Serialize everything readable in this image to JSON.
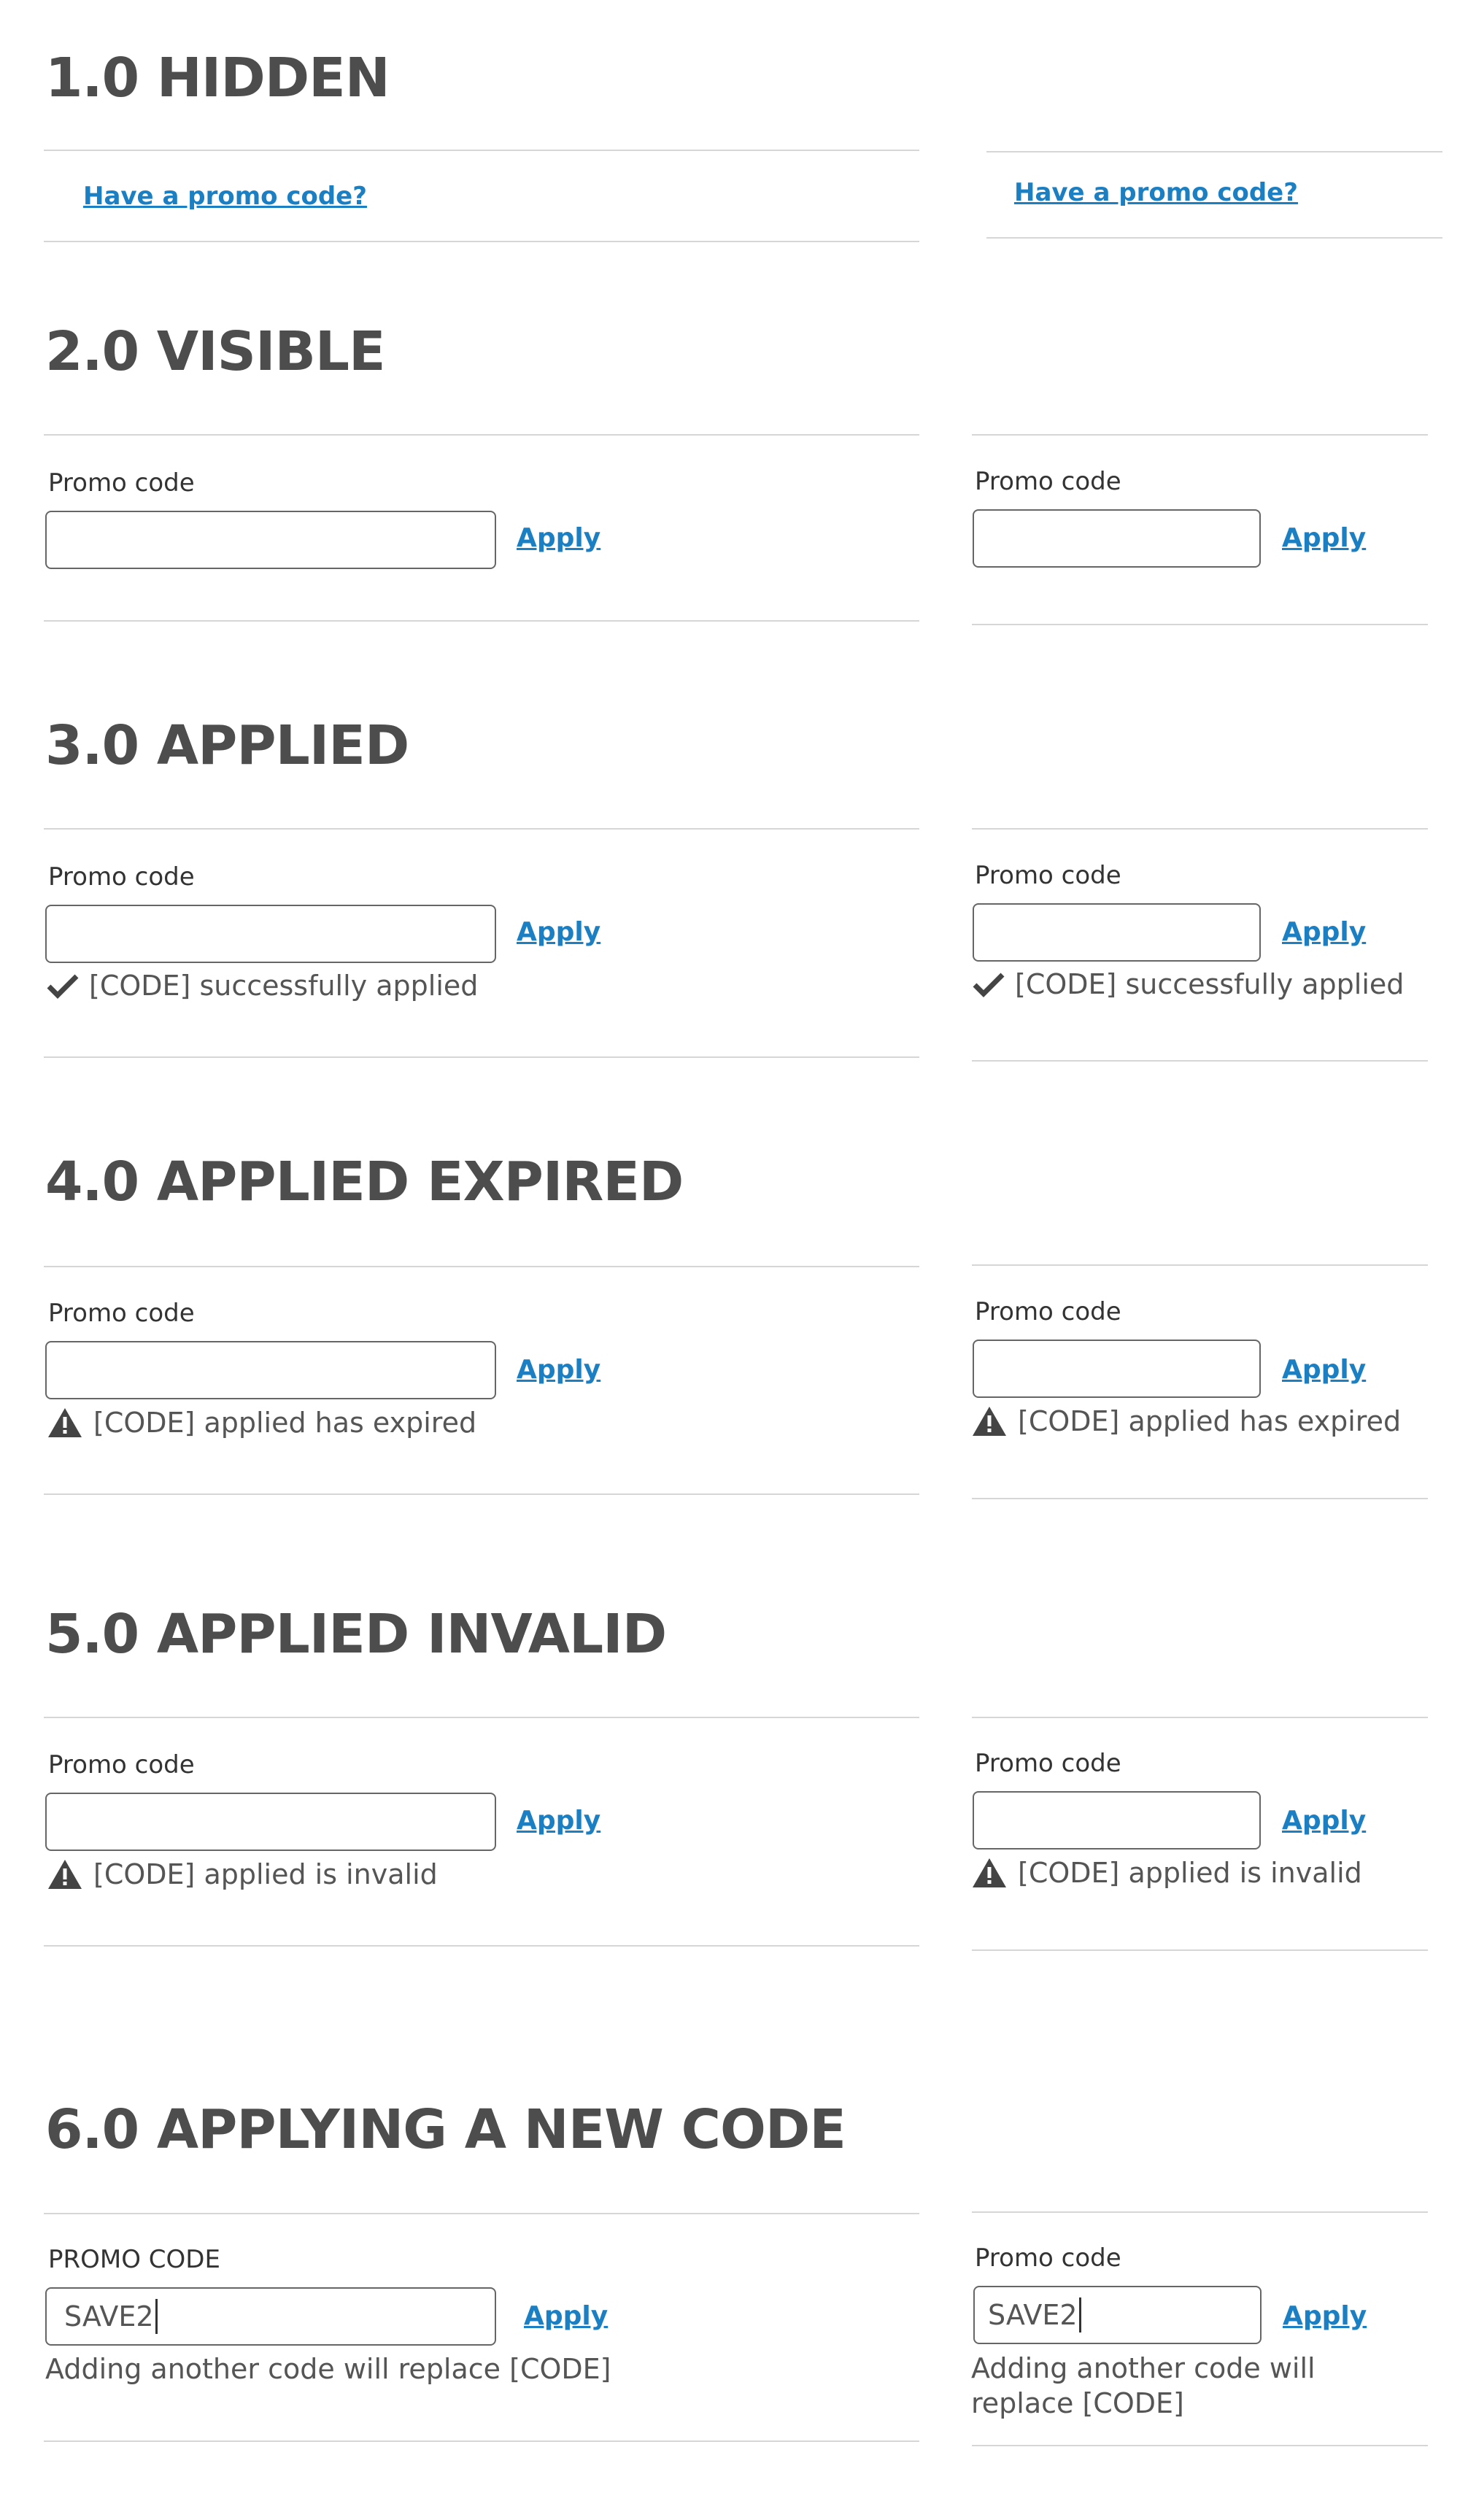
{
  "sections": {
    "hidden": {
      "title": "1.0 HIDDEN",
      "link": "Have a promo code?"
    },
    "visible": {
      "title": "2.0 VISIBLE"
    },
    "applied": {
      "title": "3.0 APPLIED",
      "message": "[CODE] successfully applied"
    },
    "expired": {
      "title": "4.0 APPLIED EXPIRED",
      "message": "[CODE] applied has expired"
    },
    "invalid": {
      "title": "5.0 APPLIED INVALID",
      "message": "[CODE] applied is invalid"
    },
    "new_code": {
      "title": "6.0 APPLYING A NEW CODE",
      "label_wide": "PROMO CODE",
      "label_narrow": "Promo code",
      "input_value": "SAVE2",
      "message": "Adding another code will replace [CODE]",
      "message_narrow_line1": "Adding another code will",
      "message_narrow_line2": "replace [CODE]"
    }
  },
  "common": {
    "promo_label": "Promo code",
    "apply_label": "Apply"
  },
  "colors": {
    "link": "#1b7fc4",
    "heading": "#4d4d4d",
    "divider": "#d6d6d6"
  },
  "icons": {
    "success": "check-icon",
    "warning": "warning-icon"
  }
}
